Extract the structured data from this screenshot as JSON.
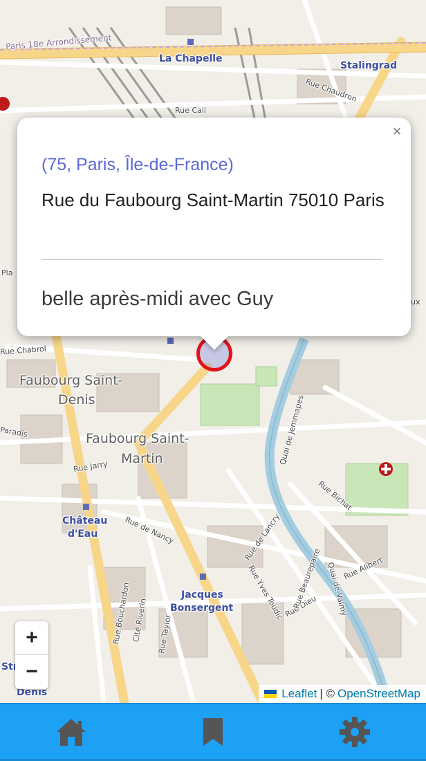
{
  "map": {
    "labels": {
      "arrondissement": "Paris 18e Arrondissement",
      "la_chapelle": "La Chapelle",
      "stalingrad": "Stalingrad",
      "rue_chaudron": "Rue Chaudron",
      "rue_cail": "Rue Cail",
      "faubourg_saint_denis_1": "Faubourg Saint-",
      "faubourg_saint_denis_2": "Denis",
      "faubourg_saint_martin_1": "Faubourg Saint-",
      "faubourg_saint_martin_2": "Martin",
      "chateau_deau_1": "Château",
      "chateau_deau_2": "d'Eau",
      "jacques_bonsergent_1": "Jacques",
      "jacques_bonsergent_2": "Bonsergent",
      "rue_chabrol": "Rue Chabrol",
      "rue_jarry": "Rue Jarry",
      "rue_de_nancy": "Rue de Nancy",
      "rue_bichat": "Rue Bichat",
      "rue_alibert": "Rue Alibert",
      "rue_dieu": "Rue Dieu",
      "rue_de_lancry": "Rue de Lancry",
      "rue_yves_toudic": "Rue Yves Toudic",
      "rue_beaurepaire": "Rue Beaurepaire",
      "quai_de_valmy": "Quai de Valmy",
      "quai_de_jemmapes": "Quai de Jemmapes",
      "rue_bouchardon": "Rue Bouchardon",
      "cite_riverin": "Cité Riverin",
      "rue_taylor": "Rue Taylor",
      "paradis": "Paradis",
      "str_frag": "Str",
      "denis_frag": "Denis",
      "pla_frag": "Pla",
      "ux_frag": "ux"
    }
  },
  "popup": {
    "region": "(75, Paris, Île-de-France)",
    "address": "Rue du Faubourg Saint-Martin 75010 Paris",
    "note": "belle après-midi avec Guy",
    "close_symbol": "×"
  },
  "zoom": {
    "in_label": "+",
    "out_label": "−"
  },
  "attribution": {
    "leaflet": "Leaflet",
    "separator": "| ©",
    "osm": "OpenStreetMap"
  },
  "nav": {
    "items": [
      {
        "icon": "home-icon"
      },
      {
        "icon": "bookmark-icon"
      },
      {
        "icon": "gear-icon"
      }
    ]
  },
  "colors": {
    "nav_bg": "#1da1f5",
    "nav_icon": "#555555",
    "marker": "#e3131b",
    "region_text": "#5b69d6",
    "canal": "#a5cde0",
    "boulevard": "#f7d68a"
  }
}
